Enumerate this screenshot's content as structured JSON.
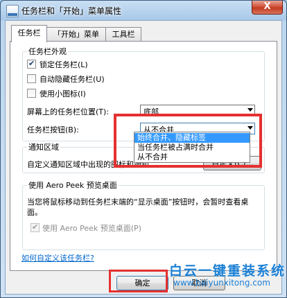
{
  "window": {
    "title": "任务栏和「开始」菜单属性",
    "close_label": "X"
  },
  "tabs": [
    {
      "label": "任务栏",
      "active": true
    },
    {
      "label": "「开始」菜单",
      "active": false
    },
    {
      "label": "工具栏",
      "active": false
    }
  ],
  "appearance": {
    "legend": "任务栏外观",
    "lock": {
      "label": "锁定任务栏(L)",
      "checked": true
    },
    "autohide": {
      "label": "自动隐藏任务栏(U)",
      "checked": false
    },
    "small_icons": {
      "label": "使用小图标(I)",
      "checked": false
    },
    "position": {
      "label": "屏幕上的任务栏位置(T):",
      "value": "底部"
    },
    "buttons": {
      "label": "任务栏按钮(B):",
      "value": "从不合并",
      "options": [
        "始终合并、隐藏标签",
        "当任务栏被占满时合并",
        "从不合并"
      ],
      "highlighted_index": 0
    }
  },
  "notification": {
    "legend": "通知区域",
    "text": "自定义通知区域中出现的图标和通知。",
    "customize_button": "自定义(C)..."
  },
  "aero": {
    "legend": "使用 Aero Peek 预览桌面",
    "description": "当您将鼠标移动到任务栏末端的“显示桌面”按钮时，会暂时查看桌面。",
    "checkbox": {
      "label": "使用 Aero Peek 预览桌面(P)",
      "checked": true,
      "disabled": true
    }
  },
  "help_link": "如何自定义该任务栏?",
  "footer": {
    "ok": "确定",
    "cancel": "取消"
  },
  "watermark": {
    "title": "白云一键重装系统",
    "url": "www.baiyunxitong.com"
  },
  "colors": {
    "highlight": "#3399ff",
    "annotation_red": "#e53030",
    "watermark": "#1a7fd4"
  }
}
